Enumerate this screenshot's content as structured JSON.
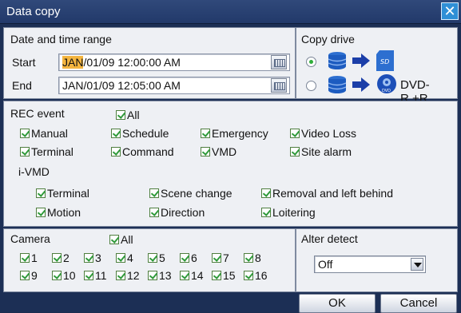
{
  "window": {
    "title": "Data copy"
  },
  "date_range": {
    "title": "Date and time range",
    "start_label": "Start",
    "start_month": "JAN",
    "start_rest": "/01/09 12:00:00 AM",
    "end_label": "End",
    "end_value": "JAN/01/09 12:05:00 AM"
  },
  "copy_drive": {
    "title": "Copy drive",
    "options": [
      {
        "selected": true,
        "target": "sd-card-icon"
      },
      {
        "selected": false,
        "target": "dvd-icon",
        "label": "DVD-R,+R"
      }
    ]
  },
  "rec_event": {
    "title": "REC event",
    "all_label": "All",
    "items": [
      "Manual",
      "Schedule",
      "Emergency",
      "Video Loss",
      "Terminal",
      "Command",
      "VMD",
      "Site alarm"
    ],
    "ivmd_label": "i-VMD",
    "ivmd_items": [
      "Terminal",
      "Scene change",
      "Removal and left behind",
      "Motion",
      "Direction",
      "Loitering"
    ]
  },
  "camera": {
    "title": "Camera",
    "all_label": "All",
    "items": [
      "1",
      "2",
      "3",
      "4",
      "5",
      "6",
      "7",
      "8",
      "9",
      "10",
      "11",
      "12",
      "13",
      "14",
      "15",
      "16"
    ]
  },
  "alter_detect": {
    "title": "Alter detect",
    "value": "Off"
  },
  "buttons": {
    "ok": "OK",
    "cancel": "Cancel"
  },
  "colors": {
    "accent": "#2f8fd6",
    "highlight": "#f4b53f",
    "check": "#2f9a3a"
  }
}
